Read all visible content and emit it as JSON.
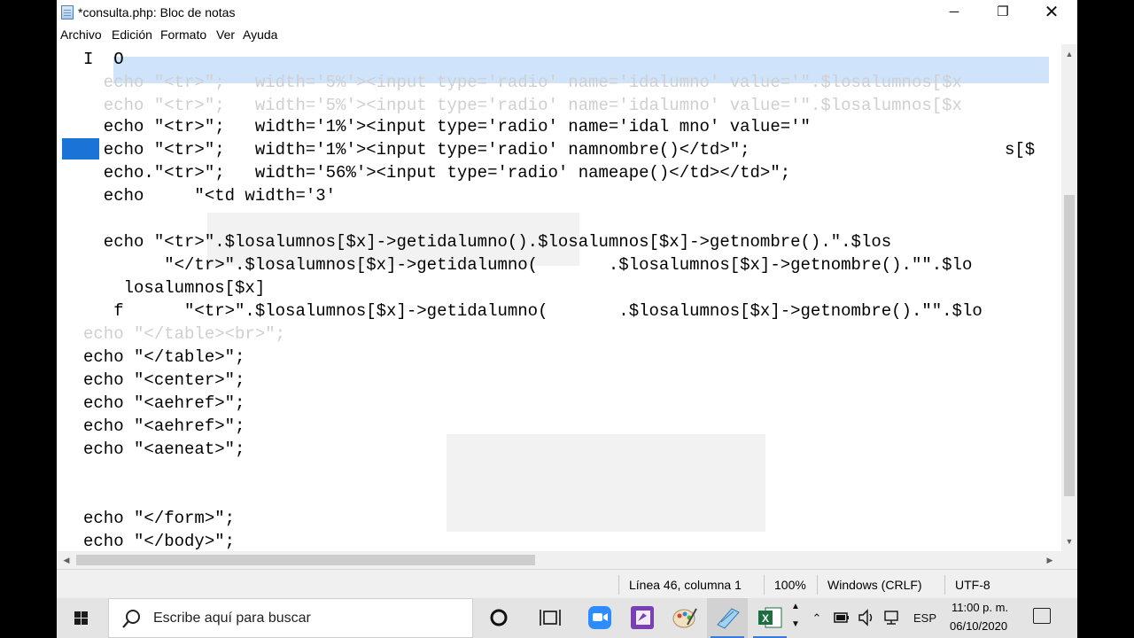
{
  "window": {
    "title": "*consulta.php: Bloc de notas",
    "minimize_glyph": "─",
    "maximize_glyph": "❐",
    "close_glyph": "✕"
  },
  "menu": {
    "items": [
      "Archivo",
      "Edición",
      "Formato",
      "Ver",
      "Ayuda"
    ]
  },
  "editor": {
    "lines": [
      "I  O",
      "  echo \"<tr>\";   width='5%'><input type='radio' name='idalumno' value='\".$losalumnos[$x",
      "  echo \"<tr>\";   width='5%'><input type='radio' name='idalumno' value='\".$losalumnos[$x",
      "  echo \"<tr>\";   width='1%'><input type='radio' name='idal mno' value='\"",
      "  echo \"<tr>\";   width='1%'><input type='radio' namnombre()</td>\";",
      "  echo.\"<tr>\";   width='56%'><input type='radio' nameape()</td></td>\";",
      "  echo     \"<td width='3'",
      "  echo \"<tr>\".$losalumnos[$x]->getidalumno().$losalumnos[$x]->getnombre().\".$los",
      "        \"</tr>\".$losalumnos[$x]->getidalumno(       .$losalumnos[$x]->getnombre().\"\".$lo",
      "    losalumnos[$x]",
      "   f      \"<tr>\".$losalumnos[$x]->getidalumno(       .$losalumnos[$x]->getnombre().\"\".$lo",
      "echo \"</table><br>\";",
      "echo \"</table>\";",
      "echo \"<center>\";",
      "echo \"<aehref>\";",
      "echo \"<aehref>\";",
      "echo \"<aeneat>\";",
      "echo \"</form>\";",
      "echo \"</body>\";"
    ],
    "right_fragment": "s[$"
  },
  "statusbar": {
    "position": "Línea 46, columna 1",
    "zoom": "100%",
    "line_ending": "Windows (CRLF)",
    "encoding": "UTF-8"
  },
  "taskbar": {
    "search_placeholder": "Escribe aquí para buscar",
    "language": "ESP",
    "time": "11:00 p. m.",
    "date": "06/10/2020"
  },
  "colors": {
    "accent": "#1a73d6",
    "selection_band": "#cfe4fb",
    "taskbar_bg": "#e4e4e4"
  },
  "icons": {
    "app": "notepad-icon",
    "start": "windows-logo-icon",
    "search": "search-icon",
    "cortana": "cortana-ring-icon",
    "task_view": "task-view-icon",
    "zoom": "zoom-app-icon",
    "onenote": "onenote-icon",
    "paint": "paint-icon",
    "notepad_taskbar": "notepad-taskbar-icon",
    "excel": "excel-icon",
    "tray_up": "chevron-up-icon",
    "battery": "battery-icon",
    "volume": "volume-icon",
    "network": "network-icon",
    "notifications": "notification-center-icon"
  }
}
